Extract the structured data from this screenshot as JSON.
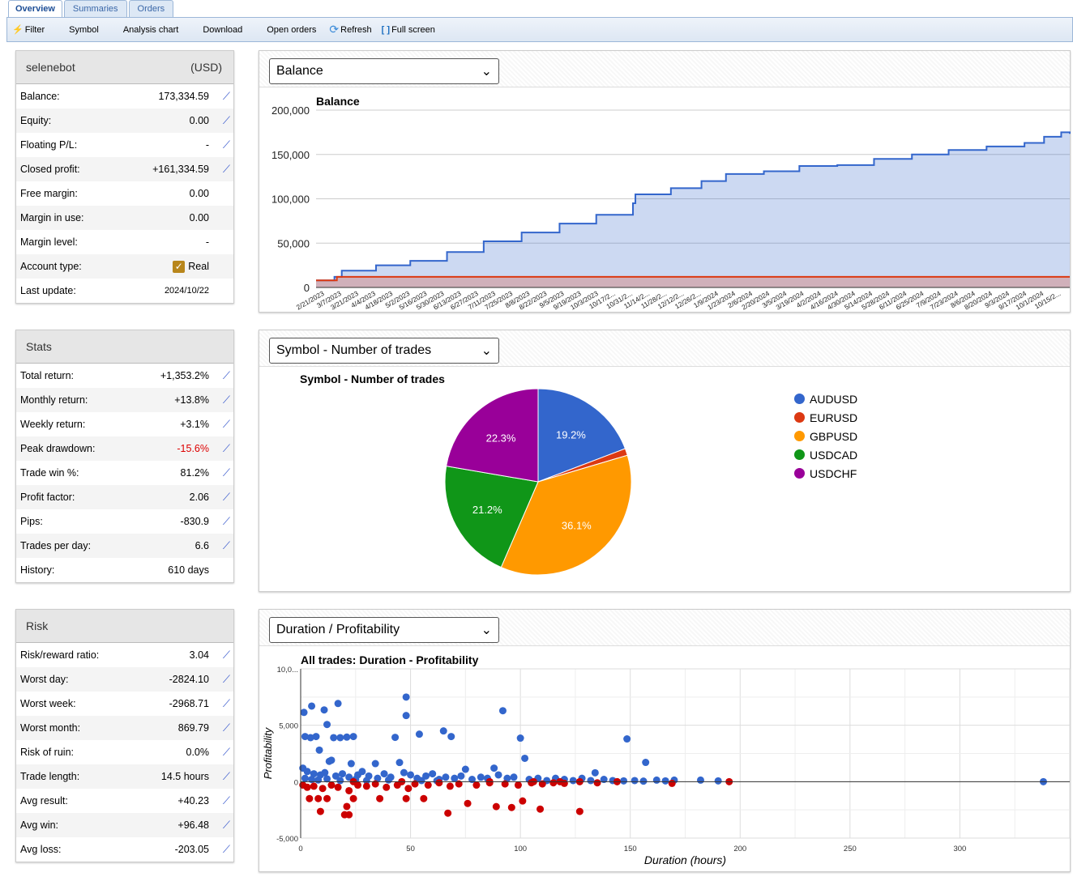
{
  "tabs": [
    "Overview",
    "Summaries",
    "Orders"
  ],
  "toolbar": {
    "filter": "Filter",
    "symbol": "Symbol",
    "analysis": "Analysis chart",
    "download": "Download",
    "open_orders": "Open orders",
    "refresh": "Refresh",
    "fullscreen": "Full screen"
  },
  "account": {
    "name": "selenebot",
    "currency": "(USD)",
    "rows": [
      {
        "label": "Balance:",
        "value": "173,334.59",
        "chart": true
      },
      {
        "label": "Equity:",
        "value": "0.00",
        "chart": true
      },
      {
        "label": "Floating P/L:",
        "value": "-",
        "chart": true
      },
      {
        "label": "Closed profit:",
        "value": "+161,334.59",
        "chart": true
      },
      {
        "label": "Free margin:",
        "value": "0.00"
      },
      {
        "label": "Margin in use:",
        "value": "0.00"
      },
      {
        "label": "Margin level:",
        "value": "-"
      },
      {
        "label": "Account type:",
        "value": "Real",
        "checkbox": true
      },
      {
        "label": "Last update:",
        "value": "2024/10/22"
      }
    ]
  },
  "stats": {
    "title": "Stats",
    "rows": [
      {
        "label": "Total return:",
        "value": "+1,353.2%"
      },
      {
        "label": "Monthly return:",
        "value": "+13.8%"
      },
      {
        "label": "Weekly return:",
        "value": "+3.1%"
      },
      {
        "label": "Peak drawdown:",
        "value": "-15.6%",
        "negative": true
      },
      {
        "label": "Trade win %:",
        "value": "81.2%"
      },
      {
        "label": "Profit factor:",
        "value": "2.06"
      },
      {
        "label": "Pips:",
        "value": "-830.9"
      },
      {
        "label": "Trades per day:",
        "value": "6.6"
      },
      {
        "label": "History:",
        "value": "610 days",
        "noicon": true
      }
    ]
  },
  "risk": {
    "title": "Risk",
    "rows": [
      {
        "label": "Risk/reward ratio:",
        "value": "3.04"
      },
      {
        "label": "Worst day:",
        "value": "-2824.10"
      },
      {
        "label": "Worst week:",
        "value": "-2968.71"
      },
      {
        "label": "Worst month:",
        "value": "869.79"
      },
      {
        "label": "Risk of ruin:",
        "value": "0.0%"
      },
      {
        "label": "Trade length:",
        "value": "14.5 hours"
      },
      {
        "label": "Avg result:",
        "value": "+40.23"
      },
      {
        "label": "Avg win:",
        "value": "+96.48"
      },
      {
        "label": "Avg loss:",
        "value": "-203.05"
      }
    ]
  },
  "colors": {
    "blue": "#3366cc",
    "red": "#cc0000",
    "negative": "#dd0000"
  },
  "chart_data": [
    {
      "type": "area",
      "select": "Balance",
      "title": "Balance",
      "ylim": [
        0,
        200000
      ],
      "yticks": [
        "0",
        "50,000",
        "100,000",
        "150,000",
        "200,000"
      ],
      "xticks": [
        "2/21/2023",
        "3/7/2023",
        "3/21/2023",
        "4/4/2023",
        "4/18/2023",
        "5/2/2023",
        "5/16/2023",
        "5/30/2023",
        "6/13/2023",
        "6/27/2023",
        "7/11/2023",
        "7/25/2023",
        "8/8/2023",
        "8/22/2023",
        "9/5/2023",
        "9/19/2023",
        "10/3/2023",
        "10/17/2...",
        "10/31/2...",
        "11/14/2...",
        "11/28/2...",
        "12/12/2...",
        "12/26/2...",
        "1/9/2024",
        "1/23/2024",
        "2/6/2024",
        "2/20/2024",
        "3/5/2024",
        "3/19/2024",
        "4/2/2024",
        "4/16/2024",
        "4/30/2024",
        "5/14/2024",
        "5/28/2024",
        "6/11/2024",
        "6/25/2024",
        "7/9/2024",
        "7/23/2024",
        "8/6/2024",
        "8/20/2024",
        "9/3/2024",
        "9/17/2024",
        "10/1/2024",
        "10/15/2..."
      ],
      "series": [
        {
          "color": "#3366cc",
          "points": [
            [
              "2023-02-14",
              8000
            ],
            [
              "2023-03-01",
              12000
            ],
            [
              "2023-03-07",
              19000
            ],
            [
              "2023-04-04",
              25000
            ],
            [
              "2023-05-02",
              30000
            ],
            [
              "2023-06-01",
              40000
            ],
            [
              "2023-07-01",
              52000
            ],
            [
              "2023-08-01",
              62000
            ],
            [
              "2023-09-01",
              72000
            ],
            [
              "2023-10-01",
              82000
            ],
            [
              "2023-10-31",
              95000
            ],
            [
              "2023-11-02",
              105000
            ],
            [
              "2023-12-01",
              112000
            ],
            [
              "2023-12-26",
              120000
            ],
            [
              "2024-01-15",
              128000
            ],
            [
              "2024-02-15",
              131000
            ],
            [
              "2024-03-15",
              137000
            ],
            [
              "2024-04-15",
              138000
            ],
            [
              "2024-05-15",
              145000
            ],
            [
              "2024-06-15",
              150000
            ],
            [
              "2024-07-15",
              155000
            ],
            [
              "2024-08-15",
              159000
            ],
            [
              "2024-09-15",
              163000
            ],
            [
              "2024-10-01",
              170000
            ],
            [
              "2024-10-15",
              175000
            ],
            [
              "2024-10-22",
              173334.59
            ]
          ]
        },
        {
          "color": "#dc3912",
          "points": [
            [
              "2023-02-14",
              8000
            ],
            [
              "2023-03-01",
              8000
            ],
            [
              "2023-03-03",
              12000
            ],
            [
              "2024-10-22",
              12000
            ]
          ]
        }
      ]
    },
    {
      "type": "pie",
      "select": "Symbol - Number of trades",
      "title": "Symbol - Number of trades",
      "slices": [
        {
          "name": "AUDUSD",
          "value": 19.2,
          "label": "19.2%",
          "color": "#3366cc"
        },
        {
          "name": "EURUSD",
          "value": 1.2,
          "label": "",
          "color": "#dc3912"
        },
        {
          "name": "GBPUSD",
          "value": 36.1,
          "label": "36.1%",
          "color": "#ff9900"
        },
        {
          "name": "USDCAD",
          "value": 21.2,
          "label": "21.2%",
          "color": "#109618"
        },
        {
          "name": "USDCHF",
          "value": 22.3,
          "label": "22.3%",
          "color": "#990099"
        }
      ]
    },
    {
      "type": "scatter",
      "select": "Duration / Profitability",
      "title": "All trades: Duration - Profitability",
      "xlabel": "Duration (hours)",
      "ylabel": "Profitability",
      "xlim": [
        0,
        350
      ],
      "ylim": [
        -5000,
        10000
      ],
      "xticks": [
        "0",
        "50",
        "100",
        "150",
        "200",
        "250",
        "300"
      ],
      "yticks": [
        "-5,000",
        "0",
        "5,000",
        "10,0..."
      ],
      "wins": [
        [
          1.5,
          6140
        ],
        [
          5,
          6700
        ],
        [
          10.7,
          6360
        ],
        [
          17,
          6930
        ],
        [
          2,
          4000
        ],
        [
          4.5,
          3900
        ],
        [
          7,
          4000
        ],
        [
          12,
          5070
        ],
        [
          15,
          3900
        ],
        [
          18,
          3900
        ],
        [
          21,
          3950
        ],
        [
          24,
          4000
        ],
        [
          8.5,
          2800
        ],
        [
          14,
          1900
        ],
        [
          48,
          7500
        ],
        [
          48,
          5860
        ],
        [
          43,
          3930
        ],
        [
          54,
          4210
        ],
        [
          65,
          4500
        ],
        [
          68.5,
          4000
        ],
        [
          92,
          6290
        ],
        [
          100,
          3860
        ],
        [
          148.5,
          3790
        ],
        [
          157,
          1710
        ],
        [
          102,
          2070
        ],
        [
          338,
          0
        ],
        [
          182,
          140
        ],
        [
          190,
          70
        ],
        [
          170,
          140
        ],
        [
          166,
          70
        ],
        [
          162,
          140
        ],
        [
          147,
          70
        ],
        [
          134,
          790
        ],
        [
          88,
          1200
        ],
        [
          75,
          1100
        ],
        [
          45,
          1700
        ],
        [
          34,
          1600
        ],
        [
          23,
          1600
        ],
        [
          13,
          1800
        ],
        [
          1,
          1200
        ],
        [
          3,
          900
        ],
        [
          6,
          700
        ],
        [
          9,
          600
        ],
        [
          11,
          800
        ],
        [
          16,
          500
        ],
        [
          19,
          700
        ],
        [
          22,
          400
        ],
        [
          26,
          600
        ],
        [
          28,
          900
        ],
        [
          31,
          500
        ],
        [
          35,
          300
        ],
        [
          38,
          700
        ],
        [
          41,
          400
        ],
        [
          47,
          800
        ],
        [
          50,
          600
        ],
        [
          53,
          300
        ],
        [
          57,
          500
        ],
        [
          60,
          700
        ],
        [
          63,
          200
        ],
        [
          66,
          400
        ],
        [
          70,
          300
        ],
        [
          73,
          500
        ],
        [
          78,
          200
        ],
        [
          82,
          400
        ],
        [
          85,
          300
        ],
        [
          90,
          600
        ],
        [
          94,
          300
        ],
        [
          97,
          400
        ],
        [
          104,
          200
        ],
        [
          108,
          300
        ],
        [
          112,
          100
        ],
        [
          116,
          300
        ],
        [
          120,
          200
        ],
        [
          124,
          100
        ],
        [
          128,
          300
        ],
        [
          132,
          100
        ],
        [
          138,
          200
        ],
        [
          142,
          100
        ],
        [
          152,
          100
        ],
        [
          156,
          50
        ],
        [
          2,
          300
        ],
        [
          5,
          200
        ],
        [
          8,
          150
        ],
        [
          12,
          250
        ],
        [
          18,
          100
        ],
        [
          25,
          200
        ],
        [
          30,
          100
        ],
        [
          40,
          150
        ],
        [
          55,
          100
        ],
        [
          62,
          80
        ]
      ],
      "losses": [
        [
          4,
          -1500
        ],
        [
          8,
          -1500
        ],
        [
          12,
          -1500
        ],
        [
          22,
          -2930
        ],
        [
          20,
          -2930
        ],
        [
          9,
          -2640
        ],
        [
          21,
          -2200
        ],
        [
          24,
          -1500
        ],
        [
          36,
          -1500
        ],
        [
          48,
          -1500
        ],
        [
          56,
          -1500
        ],
        [
          67,
          -2790
        ],
        [
          76,
          -1930
        ],
        [
          89,
          -2210
        ],
        [
          96,
          -2290
        ],
        [
          101,
          -1710
        ],
        [
          109,
          -2430
        ],
        [
          127,
          -2640
        ],
        [
          195,
          0
        ],
        [
          169,
          -150
        ],
        [
          144,
          0
        ],
        [
          127,
          0
        ],
        [
          1,
          -300
        ],
        [
          3,
          -500
        ],
        [
          6,
          -400
        ],
        [
          10,
          -600
        ],
        [
          14,
          -300
        ],
        [
          17,
          -500
        ],
        [
          22,
          -800
        ],
        [
          26,
          -300
        ],
        [
          30,
          -400
        ],
        [
          34,
          -200
        ],
        [
          39,
          -500
        ],
        [
          44,
          -300
        ],
        [
          49,
          -600
        ],
        [
          52,
          -200
        ],
        [
          58,
          -300
        ],
        [
          63,
          -100
        ],
        [
          68,
          -400
        ],
        [
          72,
          -200
        ],
        [
          80,
          -300
        ],
        [
          86,
          -100
        ],
        [
          93,
          -200
        ],
        [
          99,
          -300
        ],
        [
          105,
          -100
        ],
        [
          110,
          -200
        ],
        [
          115,
          -100
        ],
        [
          120,
          -150
        ],
        [
          135,
          -100
        ],
        [
          24,
          0
        ],
        [
          46,
          0
        ],
        [
          86,
          0
        ],
        [
          106,
          0
        ],
        [
          118,
          0
        ]
      ]
    }
  ]
}
